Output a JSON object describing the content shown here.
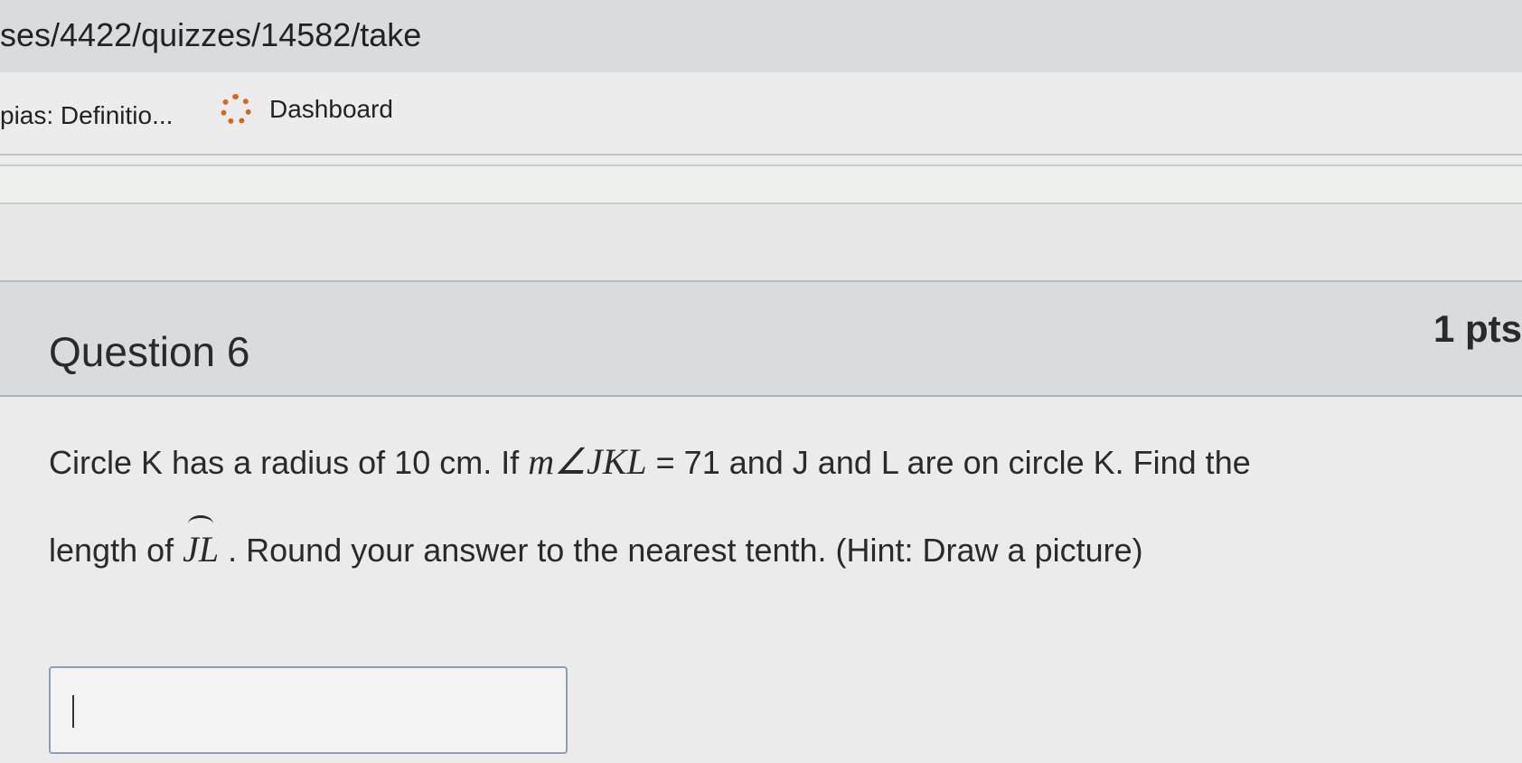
{
  "browser": {
    "url_fragment": "ses/4422/quizzes/14582/take",
    "bookmarks": [
      {
        "label": "pias: Definitio..."
      },
      {
        "label": "Dashboard",
        "icon": "loading-circle-icon"
      }
    ]
  },
  "question": {
    "title": "Question 6",
    "points": "1 pts",
    "line1_prefix": "Circle K has a radius of 10 cm.  If ",
    "line1_math": "m∠JKL",
    "line1_suffix": " = 71 and J and L are on circle K.  Find the",
    "line2_prefix": "length of ",
    "line2_math": "JL",
    "line2_suffix": " . Round your answer to the nearest tenth.  (Hint: Draw a picture)",
    "answer_value": ""
  },
  "colors": {
    "header_bg": "#d8dcdf",
    "bookmark_icon": "#d2691e"
  }
}
